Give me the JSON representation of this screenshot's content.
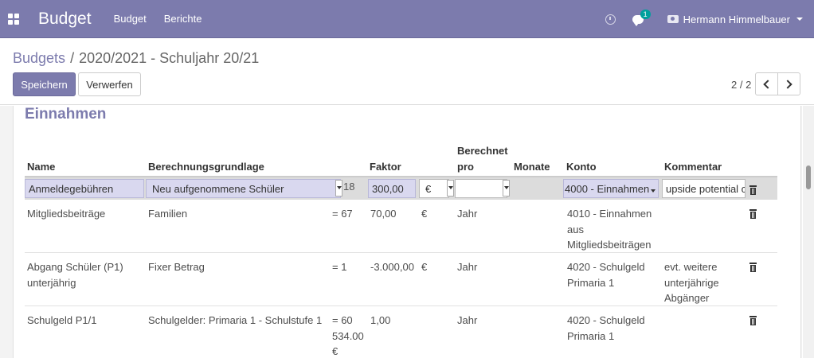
{
  "navbar": {
    "app_title": "Budget",
    "menu": [
      "Budget",
      "Berichte"
    ],
    "chat_badge": "1",
    "user_name": "Hermann Himmelbauer"
  },
  "breadcrumb": {
    "parent": "Budgets",
    "separator": "/",
    "current": "2020/2021 - Schuljahr 20/21"
  },
  "actions": {
    "save_label": "Speichern",
    "discard_label": "Verwerfen"
  },
  "pager": {
    "value": "2 / 2"
  },
  "section": {
    "title": "Einnahmen"
  },
  "table": {
    "columns": {
      "name": "Name",
      "basis": "Berechnungsgrundlage",
      "factor": "Faktor",
      "per_line1": "Berechnet",
      "per_line2": "pro",
      "months": "Monate",
      "account": "Konto",
      "comment": "Kommentar"
    },
    "edit_row": {
      "name": "Anmeldegebühren",
      "basis": "Neu aufgenommene Schüler",
      "count": "18",
      "factor": "300,00",
      "currency": "€",
      "per": "",
      "months": "",
      "account": "4000 - Einnahmen",
      "comment": "upside potential c"
    },
    "rows": [
      {
        "name": "Mitgliedsbeiträge",
        "basis": "Familien",
        "count": "= 67",
        "factor": "70,00",
        "currency": "€",
        "per": "Jahr",
        "account": "4010 - Einnahmen aus Mitgliedsbeiträgen",
        "comment": ""
      },
      {
        "name": "Abgang Schüler (P1) unterjährig",
        "basis": "Fixer Betrag",
        "count": "= 1",
        "factor": "-3.000,00",
        "currency": "€",
        "per": "Jahr",
        "account": "4020 - Schulgeld Primaria 1",
        "comment": "evt. weitere unterjährige Abgänger"
      },
      {
        "name": "Schulgeld P1/1",
        "basis": "Schulgelder: Primaria 1 - Schulstufe 1",
        "count": "= 60 534.00 €",
        "factor": "1,00",
        "currency": "",
        "per": "Jahr",
        "account": "4020 - Schulgeld Primaria 1",
        "comment": ""
      }
    ]
  }
}
